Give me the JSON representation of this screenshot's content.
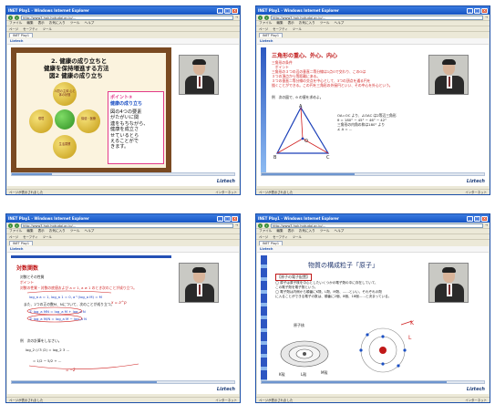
{
  "browser": {
    "title": "INET Play1 - Windows Internet Explorer",
    "url": "http://www3.hpk.hokudai.ac.jp/...",
    "menu": [
      "ファイル",
      "編集",
      "表示",
      "お気に入り",
      "ツール",
      "ヘルプ"
    ],
    "toolbar": [
      "ページ",
      "セーフティ",
      "ツール"
    ],
    "tab": "INET Play1",
    "status_left": "ページが表示されました",
    "status_right": "インターネット",
    "go": "→",
    "brand": "Liztech"
  },
  "windows": [
    {
      "progress": 0.18,
      "slide": {
        "title1": "2. 健康の成り立ちと",
        "title2": "健康を保持増進する方法",
        "title3": "図2 健康の成り立ち",
        "balls": [
          "人間の主体 心と体の状態",
          "環境",
          "生活習慣",
          "保健・医療"
        ],
        "point_head": "ポイント③",
        "point_sub": "健康の成り立ち",
        "point_body": "図の4つの要素\nがたがいに関\n連をもちながら、\n健康を成立さ\nせているとら\nえることがで\nきます。"
      }
    },
    {
      "progress": 0.42,
      "slide": {
        "title": "三角形の重心、外心、内心",
        "text1": "三角形の条件\n　ポイント\n三角形の３つの辺の垂直二等分線は1点Oで交わり、このOは\n３つの頂点から等距離にある。\n３つの垂直二等分線の交点を中心として、3つの頂点を通る円を\n描くことができる。この円を三角形の外接円といい、その中心を外心という。",
        "text2": "例　次の図で、θ の値を求めよ。",
        "text3": "OA=OC より、∠OAC は2等辺三角形\nθ = 180° − 45° − 46° − 42°\n三角形の内角の和は180° より\n∠ A = ...",
        "labels": [
          "A",
          "B",
          "C",
          "O"
        ]
      }
    },
    {
      "progress": 0.65,
      "slide": {
        "title": "対数関数",
        "lines": [
          "対数とその性質",
          "ポイント",
          "対数の性質・対数の底値および a > 1, a ≠ 1 のとき次のことが成り立つ。",
          "log_a a = 1,   log_a 1 = 0,   a^(log_a M) = M",
          "また、2つの正の数M、Nについて、次のことが成り立つ。",
          "① log_a MN = log_a M + log_a N",
          "② log_a M/N = log_a M − log_a N",
          "例　次の計算をしなさい。",
          "log_2 (√3 /2) = log_2 3 ...",
          "= 1/2 − 5/2 + ..."
        ],
        "handwriting": [
          "x = a^p",
          "= −2"
        ]
      }
    },
    {
      "progress": 0.83,
      "slide": {
        "title": "物質の構成粒子「原子」",
        "subtitle": "【原子の電子配置】",
        "text": "◯ 原子は原子核を中心としたいくつかの電子殻の中に存在していて、\nこの電子殻を電子殻という。\n◯ 電子殻は内側から順番にK殻、L殻、M殻、……といい、それぞれの殻\nに入ることができる電子の数は、順番に2個、8個、18個……と決まっている。",
        "labels": [
          "原子核",
          "K殻",
          "L殻",
          "M殻",
          "K",
          "L"
        ]
      }
    }
  ]
}
